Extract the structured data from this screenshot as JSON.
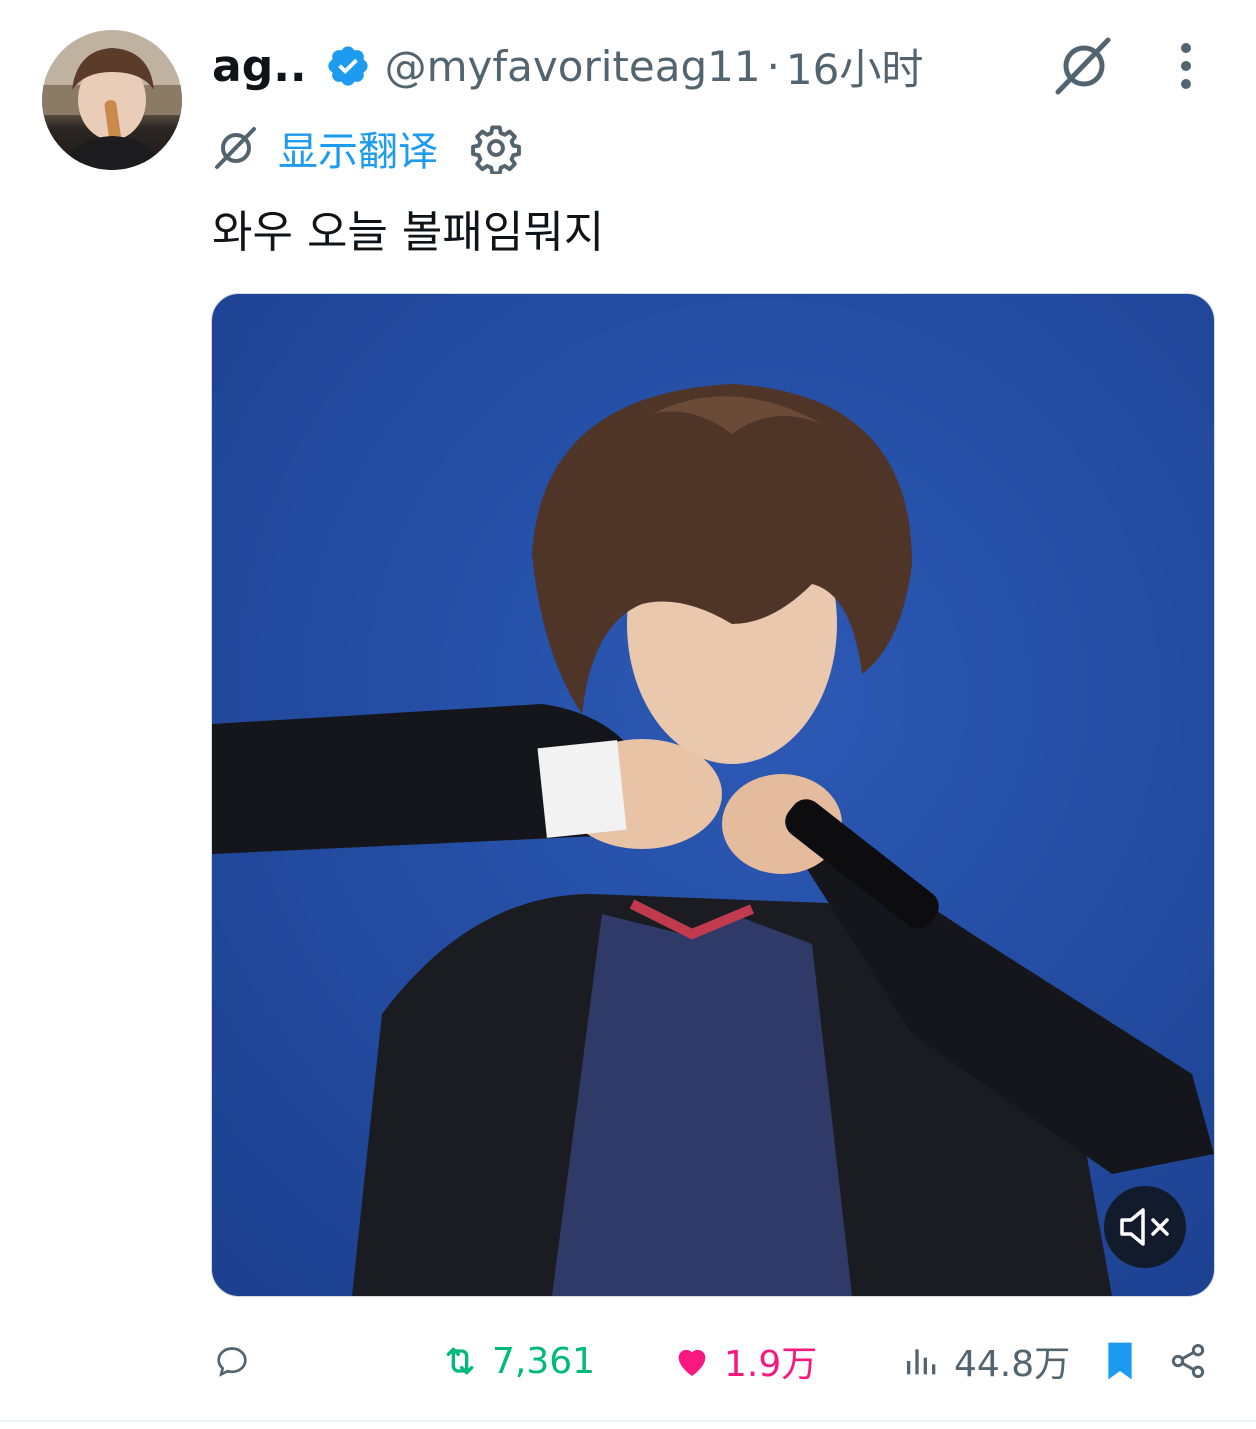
{
  "tweet": {
    "author": {
      "display_name": "ag..",
      "handle": "@myfavoriteag11",
      "verified_icon": "verified-badge-icon",
      "avatar_desc": "avatar"
    },
    "separator": "·",
    "timestamp": "16小时",
    "translate_label": "显示翻译",
    "text": "와우 오늘 볼패임뭐지",
    "media": {
      "type": "video",
      "muted_icon": "volume-muted-icon"
    },
    "actions": {
      "reply_count": "",
      "retweet_count": "7,361",
      "like_count": "1.9万",
      "views_count": "44.8万"
    }
  },
  "colors": {
    "accent": "#1d9bf0",
    "retweet": "#00ba7c",
    "like": "#f91880",
    "muted_text": "#536471"
  }
}
